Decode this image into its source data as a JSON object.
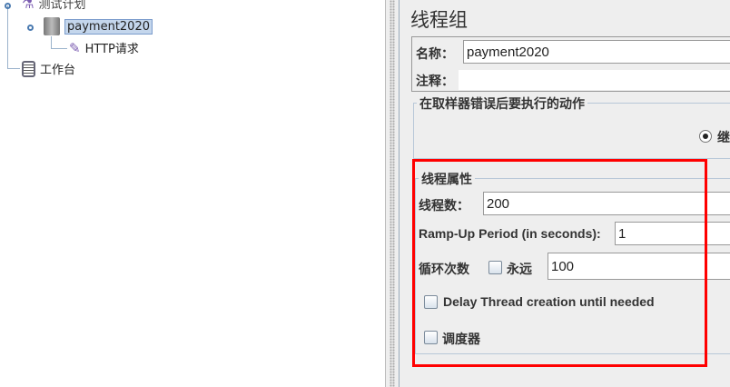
{
  "tree": {
    "items": [
      {
        "label": "测试计划"
      },
      {
        "label": "payment2020"
      },
      {
        "label": "HTTP请求"
      },
      {
        "label": "工作台"
      }
    ]
  },
  "panel": {
    "title": "线程组",
    "name_label": "名称：",
    "name_value": "payment2020",
    "comment_label": "注释：",
    "comment_value": "",
    "error_group_title": "在取样器错误后要执行的动作",
    "error_radio_label": "继",
    "thread_group_title": "线程属性",
    "threads_label": "线程数：",
    "threads_value": "200",
    "rampup_label": "Ramp-Up Period (in seconds):",
    "rampup_value": "1",
    "loop_label": "循环次数",
    "forever_label": "永远",
    "loop_value": "100",
    "delay_label": "Delay Thread creation until needed",
    "scheduler_label": "调度器"
  },
  "colors": {
    "highlight": "#ff0000",
    "selection": "#c4d6ec"
  }
}
